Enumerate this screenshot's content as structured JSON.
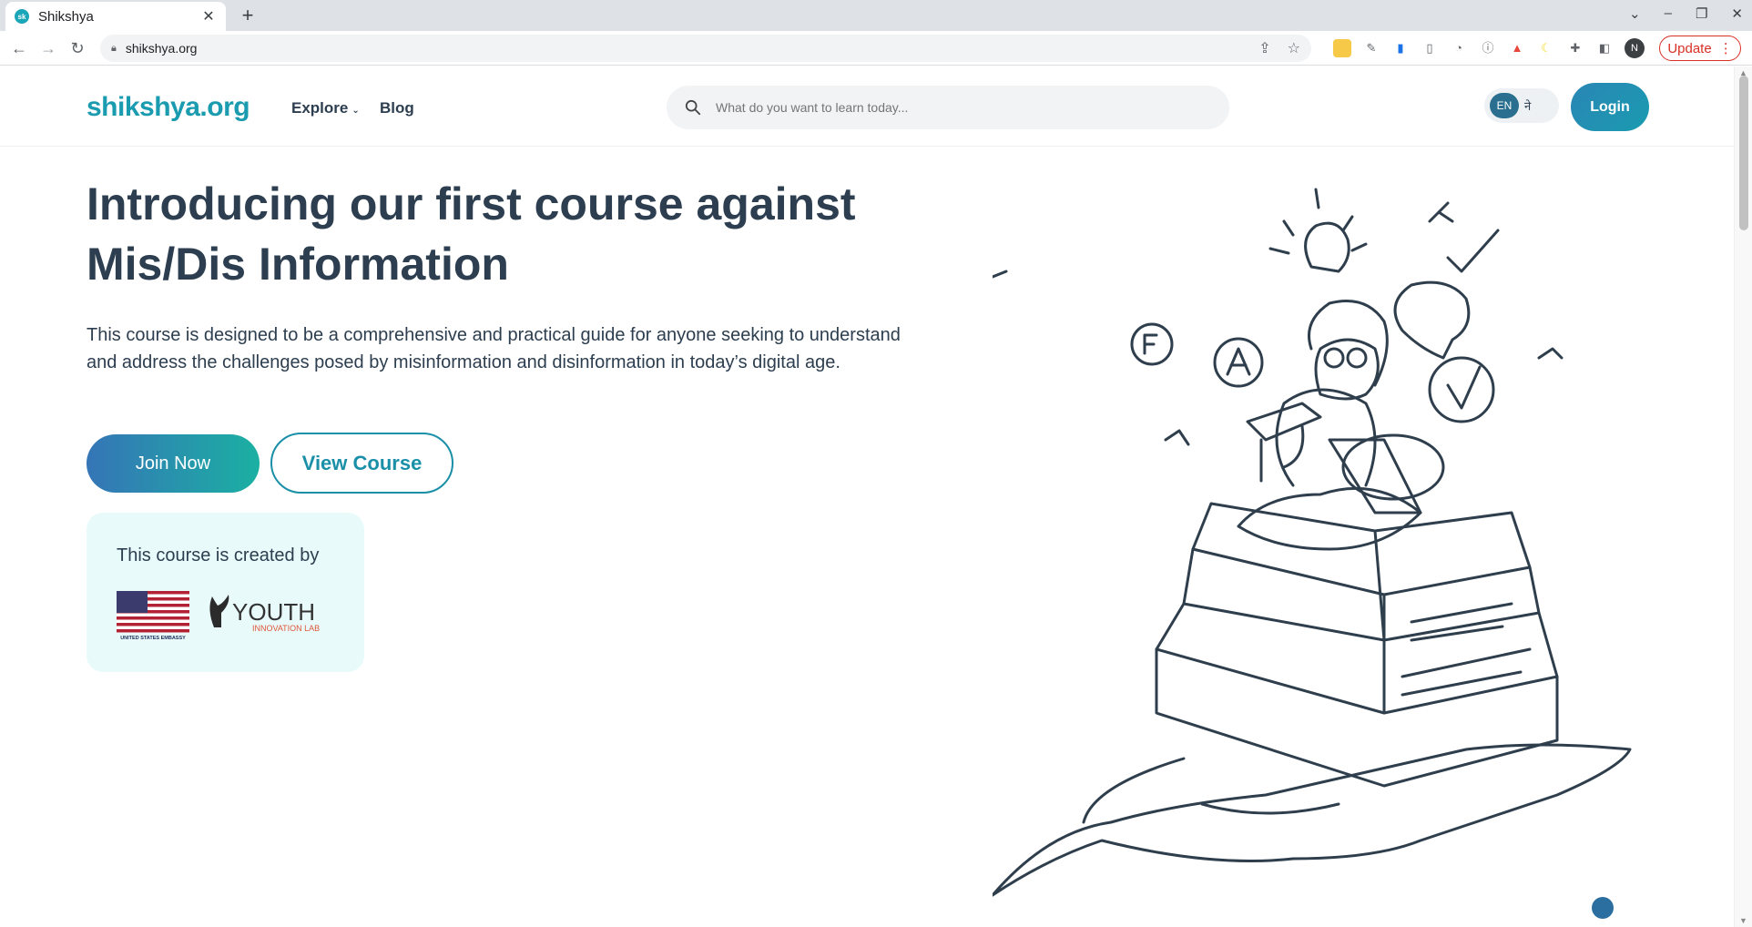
{
  "browser": {
    "tab_title": "Shikshya",
    "tab_favicon": "sk",
    "url": "shikshya.org",
    "update_label": "Update",
    "profile_initial": "N"
  },
  "header": {
    "logo": "shikshya.org",
    "nav": {
      "explore": "Explore",
      "blog": "Blog"
    },
    "search_placeholder": "What do you want to learn today...",
    "lang_en": "EN",
    "lang_ne": "ने",
    "login": "Login"
  },
  "hero": {
    "title": "Introducing our first course against Mis/Dis Information",
    "description": "This course is designed to be a comprehensive and practical guide for anyone seeking to understand and address the challenges posed by misinformation and disinformation in today’s digital age.",
    "join_button": "Join Now",
    "view_button": "View Course"
  },
  "credits": {
    "title": "This course is created by",
    "embassy_caption": "UNITED STATES EMBASSY",
    "yil_main": "YOUTH",
    "yil_sub": "INNOVATION LAB"
  },
  "colors": {
    "brand": "#1a9bb0",
    "heading": "#2c3e4f",
    "credit_bg": "#e8fbfa"
  }
}
